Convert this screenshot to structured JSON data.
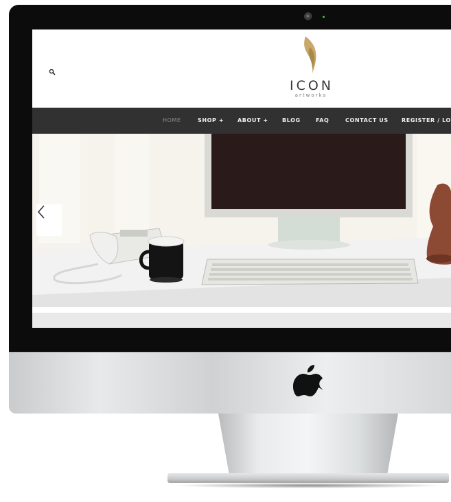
{
  "site": {
    "logo_name": "ICON",
    "logo_sub": "artworks",
    "logo_color": "#c8a96a"
  },
  "nav": {
    "items": [
      {
        "label": "HOME",
        "active": true
      },
      {
        "label": "SHOP +",
        "active": false
      },
      {
        "label": "ABOUT +",
        "active": false
      },
      {
        "label": "BLOG",
        "active": false
      },
      {
        "label": "FAQ",
        "active": false
      },
      {
        "label": "CONTACT US",
        "active": false
      },
      {
        "label": "REGISTER / LOGIN",
        "active": false
      }
    ],
    "background": "#313131"
  },
  "icons": {
    "search": "search-icon",
    "slider_prev": "chevron-left-icon",
    "brand": "apple-logo-icon"
  },
  "device": {
    "camera_led_color": "#38c94b"
  }
}
